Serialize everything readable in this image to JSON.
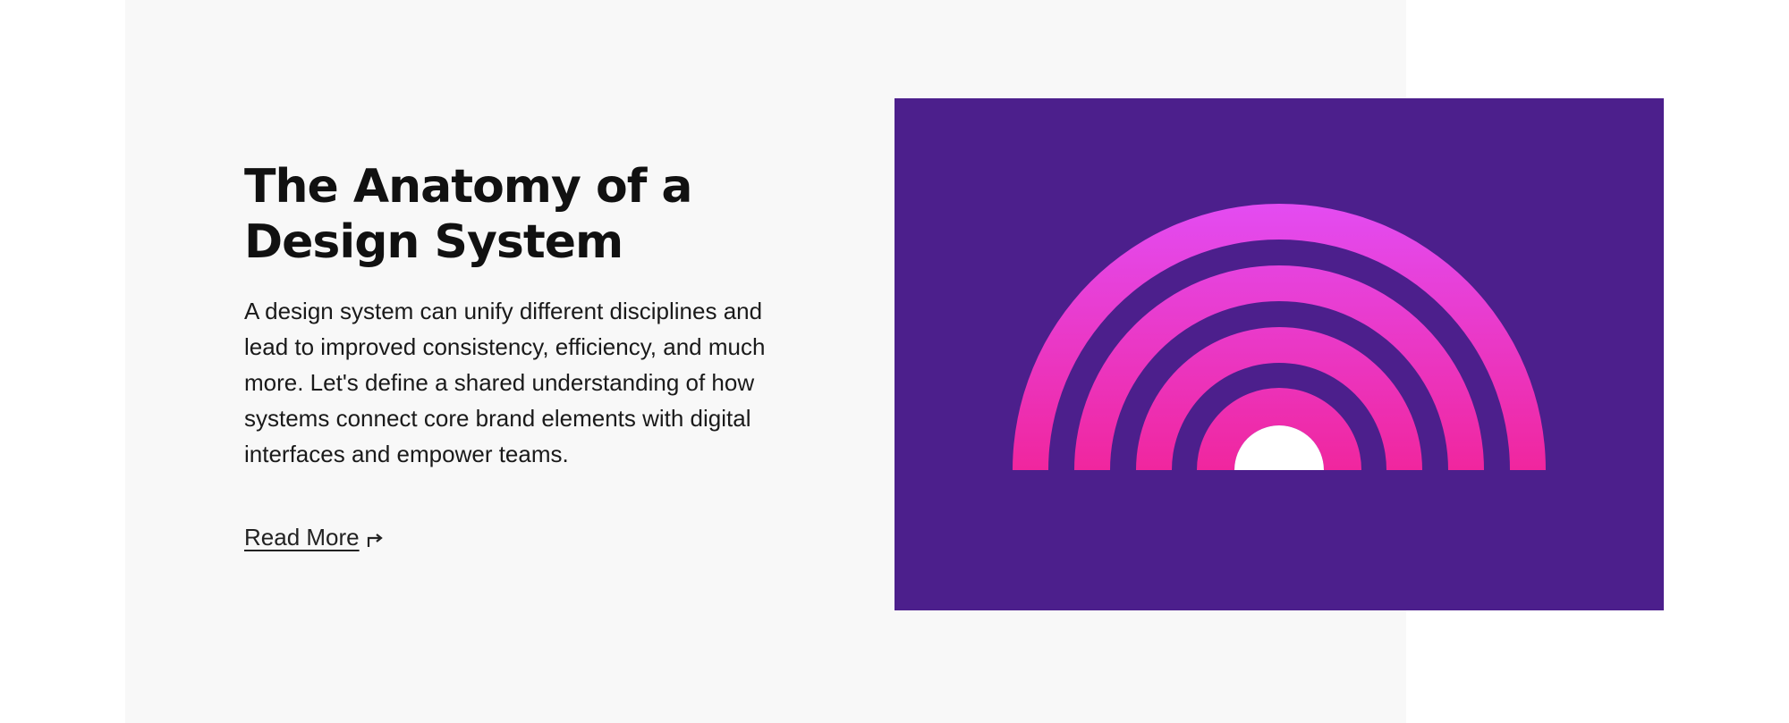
{
  "article": {
    "title_line1": "The Anatomy of a",
    "title_line2": "Design System",
    "description": "A design system can unify different disciplines and lead to improved consistency, efficiency, and much more. Let's define a shared understanding of how systems connect core brand elements with digital interfaces and empower teams.",
    "read_more_label": "Read More",
    "read_more_icon": "arrow-turn-right-icon"
  },
  "illustration": {
    "name": "rainbow-arches-illustration",
    "background_color": "#4c1f8c",
    "gradient_top": "#e34cf2",
    "gradient_bottom": "#f0269e",
    "center_color": "#ffffff"
  },
  "colors": {
    "card_background": "#f8f8f8",
    "text": "#111111"
  }
}
